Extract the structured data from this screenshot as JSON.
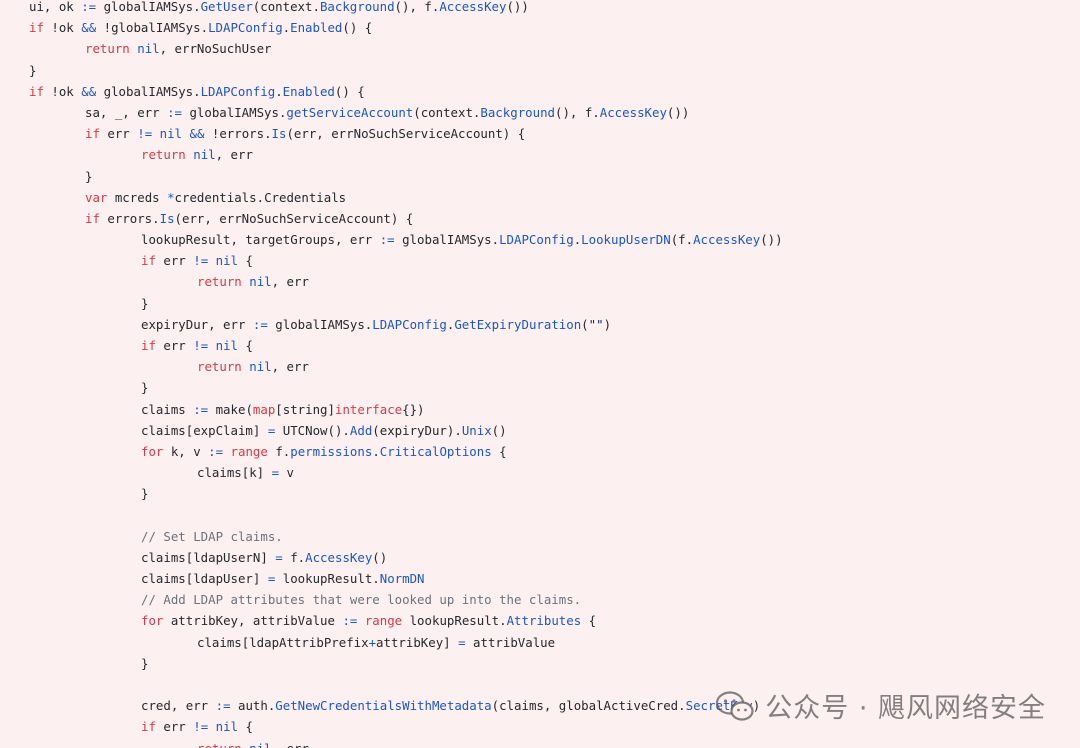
{
  "code": {
    "lines": [
      {
        "indent": 0,
        "tokens": [
          [
            "id",
            "ui, ok "
          ],
          [
            "op",
            ":="
          ],
          [
            "id",
            " globalIAMSys."
          ],
          [
            "fn",
            "GetUser"
          ],
          [
            "id",
            "(context."
          ],
          [
            "fn",
            "Background"
          ],
          [
            "id",
            "(), f."
          ],
          [
            "fn",
            "AccessKey"
          ],
          [
            "id",
            "())"
          ]
        ]
      },
      {
        "indent": 0,
        "tokens": [
          [
            "kw",
            "if"
          ],
          [
            "id",
            " !ok "
          ],
          [
            "op",
            "&&"
          ],
          [
            "id",
            " !globalIAMSys."
          ],
          [
            "fn",
            "LDAPConfig"
          ],
          [
            "id",
            "."
          ],
          [
            "fn",
            "Enabled"
          ],
          [
            "id",
            "() {"
          ]
        ]
      },
      {
        "indent": 1,
        "tokens": [
          [
            "kw",
            "return"
          ],
          [
            "id",
            " "
          ],
          [
            "fn",
            "nil"
          ],
          [
            "id",
            ", errNoSuchUser"
          ]
        ]
      },
      {
        "indent": 0,
        "tokens": [
          [
            "id",
            "}"
          ]
        ]
      },
      {
        "indent": 0,
        "tokens": [
          [
            "kw",
            "if"
          ],
          [
            "id",
            " !ok "
          ],
          [
            "op",
            "&&"
          ],
          [
            "id",
            " globalIAMSys."
          ],
          [
            "fn",
            "LDAPConfig"
          ],
          [
            "id",
            "."
          ],
          [
            "fn",
            "Enabled"
          ],
          [
            "id",
            "() {"
          ]
        ]
      },
      {
        "indent": 1,
        "tokens": [
          [
            "id",
            "sa, _, err "
          ],
          [
            "op",
            ":="
          ],
          [
            "id",
            " globalIAMSys."
          ],
          [
            "fn",
            "getServiceAccount"
          ],
          [
            "id",
            "(context."
          ],
          [
            "fn",
            "Background"
          ],
          [
            "id",
            "(), f."
          ],
          [
            "fn",
            "AccessKey"
          ],
          [
            "id",
            "())"
          ]
        ]
      },
      {
        "indent": 1,
        "tokens": [
          [
            "kw",
            "if"
          ],
          [
            "id",
            " err "
          ],
          [
            "op",
            "!="
          ],
          [
            "id",
            " "
          ],
          [
            "fn",
            "nil"
          ],
          [
            "id",
            " "
          ],
          [
            "op",
            "&&"
          ],
          [
            "id",
            " !errors."
          ],
          [
            "fn",
            "Is"
          ],
          [
            "id",
            "(err, errNoSuchServiceAccount) {"
          ]
        ]
      },
      {
        "indent": 2,
        "tokens": [
          [
            "kw",
            "return"
          ],
          [
            "id",
            " "
          ],
          [
            "fn",
            "nil"
          ],
          [
            "id",
            ", err"
          ]
        ]
      },
      {
        "indent": 1,
        "tokens": [
          [
            "id",
            "}"
          ]
        ]
      },
      {
        "indent": 1,
        "tokens": [
          [
            "kw",
            "var"
          ],
          [
            "id",
            " mcreds "
          ],
          [
            "op",
            "*"
          ],
          [
            "id",
            "credentials.Credentials"
          ]
        ]
      },
      {
        "indent": 1,
        "tokens": [
          [
            "kw",
            "if"
          ],
          [
            "id",
            " errors."
          ],
          [
            "fn",
            "Is"
          ],
          [
            "id",
            "(err, errNoSuchServiceAccount) {"
          ]
        ]
      },
      {
        "indent": 2,
        "tokens": [
          [
            "id",
            "lookupResult, targetGroups, err "
          ],
          [
            "op",
            ":="
          ],
          [
            "id",
            " globalIAMSys."
          ],
          [
            "fn",
            "LDAPConfig"
          ],
          [
            "id",
            "."
          ],
          [
            "fn",
            "LookupUserDN"
          ],
          [
            "id",
            "(f."
          ],
          [
            "fn",
            "AccessKey"
          ],
          [
            "id",
            "())"
          ]
        ]
      },
      {
        "indent": 2,
        "tokens": [
          [
            "kw",
            "if"
          ],
          [
            "id",
            " err "
          ],
          [
            "op",
            "!="
          ],
          [
            "id",
            " "
          ],
          [
            "fn",
            "nil"
          ],
          [
            "id",
            " {"
          ]
        ]
      },
      {
        "indent": 3,
        "tokens": [
          [
            "kw",
            "return"
          ],
          [
            "id",
            " "
          ],
          [
            "fn",
            "nil"
          ],
          [
            "id",
            ", err"
          ]
        ]
      },
      {
        "indent": 2,
        "tokens": [
          [
            "id",
            "}"
          ]
        ]
      },
      {
        "indent": 2,
        "tokens": [
          [
            "id",
            "expiryDur, err "
          ],
          [
            "op",
            ":="
          ],
          [
            "id",
            " globalIAMSys."
          ],
          [
            "fn",
            "LDAPConfig"
          ],
          [
            "id",
            "."
          ],
          [
            "fn",
            "GetExpiryDuration"
          ],
          [
            "id",
            "("
          ],
          [
            "str",
            "\"\""
          ],
          [
            "id",
            ")"
          ]
        ]
      },
      {
        "indent": 2,
        "tokens": [
          [
            "kw",
            "if"
          ],
          [
            "id",
            " err "
          ],
          [
            "op",
            "!="
          ],
          [
            "id",
            " "
          ],
          [
            "fn",
            "nil"
          ],
          [
            "id",
            " {"
          ]
        ]
      },
      {
        "indent": 3,
        "tokens": [
          [
            "kw",
            "return"
          ],
          [
            "id",
            " "
          ],
          [
            "fn",
            "nil"
          ],
          [
            "id",
            ", err"
          ]
        ]
      },
      {
        "indent": 2,
        "tokens": [
          [
            "id",
            "}"
          ]
        ]
      },
      {
        "indent": 2,
        "tokens": [
          [
            "id",
            "claims "
          ],
          [
            "op",
            ":="
          ],
          [
            "id",
            " make("
          ],
          [
            "kw",
            "map"
          ],
          [
            "id",
            "[string]"
          ],
          [
            "kw",
            "interface"
          ],
          [
            "id",
            "{})"
          ]
        ]
      },
      {
        "indent": 2,
        "tokens": [
          [
            "id",
            "claims[expClaim] "
          ],
          [
            "op",
            "="
          ],
          [
            "id",
            " UTCNow()."
          ],
          [
            "fn",
            "Add"
          ],
          [
            "id",
            "(expiryDur)."
          ],
          [
            "fn",
            "Unix"
          ],
          [
            "id",
            "()"
          ]
        ]
      },
      {
        "indent": 2,
        "tokens": [
          [
            "kw",
            "for"
          ],
          [
            "id",
            " k, v "
          ],
          [
            "op",
            ":="
          ],
          [
            "id",
            " "
          ],
          [
            "kw",
            "range"
          ],
          [
            "id",
            " f."
          ],
          [
            "fn",
            "permissions"
          ],
          [
            "id",
            "."
          ],
          [
            "fn",
            "CriticalOptions"
          ],
          [
            "id",
            " {"
          ]
        ]
      },
      {
        "indent": 3,
        "tokens": [
          [
            "id",
            "claims[k] "
          ],
          [
            "op",
            "="
          ],
          [
            "id",
            " v"
          ]
        ]
      },
      {
        "indent": 2,
        "tokens": [
          [
            "id",
            "}"
          ]
        ]
      },
      {
        "indent": 2,
        "tokens": []
      },
      {
        "indent": 2,
        "tokens": [
          [
            "cm",
            "// Set LDAP claims."
          ]
        ]
      },
      {
        "indent": 2,
        "tokens": [
          [
            "id",
            "claims[ldapUserN] "
          ],
          [
            "op",
            "="
          ],
          [
            "id",
            " f."
          ],
          [
            "fn",
            "AccessKey"
          ],
          [
            "id",
            "()"
          ]
        ]
      },
      {
        "indent": 2,
        "tokens": [
          [
            "id",
            "claims[ldapUser] "
          ],
          [
            "op",
            "="
          ],
          [
            "id",
            " lookupResult."
          ],
          [
            "fn",
            "NormDN"
          ]
        ]
      },
      {
        "indent": 2,
        "tokens": [
          [
            "cm",
            "// Add LDAP attributes that were looked up into the claims."
          ]
        ]
      },
      {
        "indent": 2,
        "tokens": [
          [
            "kw",
            "for"
          ],
          [
            "id",
            " attribKey, attribValue "
          ],
          [
            "op",
            ":="
          ],
          [
            "id",
            " "
          ],
          [
            "kw",
            "range"
          ],
          [
            "id",
            " lookupResult."
          ],
          [
            "fn",
            "Attributes"
          ],
          [
            "id",
            " {"
          ]
        ]
      },
      {
        "indent": 3,
        "tokens": [
          [
            "id",
            "claims[ldapAttribPrefix"
          ],
          [
            "op",
            "+"
          ],
          [
            "id",
            "attribKey] "
          ],
          [
            "op",
            "="
          ],
          [
            "id",
            " attribValue"
          ]
        ]
      },
      {
        "indent": 2,
        "tokens": [
          [
            "id",
            "}"
          ]
        ]
      },
      {
        "indent": 2,
        "tokens": []
      },
      {
        "indent": 2,
        "tokens": [
          [
            "id",
            "cred, err "
          ],
          [
            "op",
            ":="
          ],
          [
            "id",
            " auth."
          ],
          [
            "fn",
            "GetNewCredentialsWithMetadata"
          ],
          [
            "id",
            "(claims, globalActiveCred."
          ],
          [
            "fn",
            "SecretKey"
          ],
          [
            "id",
            ")"
          ]
        ]
      },
      {
        "indent": 2,
        "tokens": [
          [
            "kw",
            "if"
          ],
          [
            "id",
            " err "
          ],
          [
            "op",
            "!="
          ],
          [
            "id",
            " "
          ],
          [
            "fn",
            "nil"
          ],
          [
            "id",
            " {"
          ]
        ]
      },
      {
        "indent": 3,
        "tokens": [
          [
            "kw",
            "return"
          ],
          [
            "id",
            " "
          ],
          [
            "fn",
            "nil"
          ],
          [
            "id",
            ", err"
          ]
        ]
      }
    ]
  },
  "watermark": {
    "text": "公众号 · 飓风网络安全",
    "icon": "wechat-icon"
  }
}
